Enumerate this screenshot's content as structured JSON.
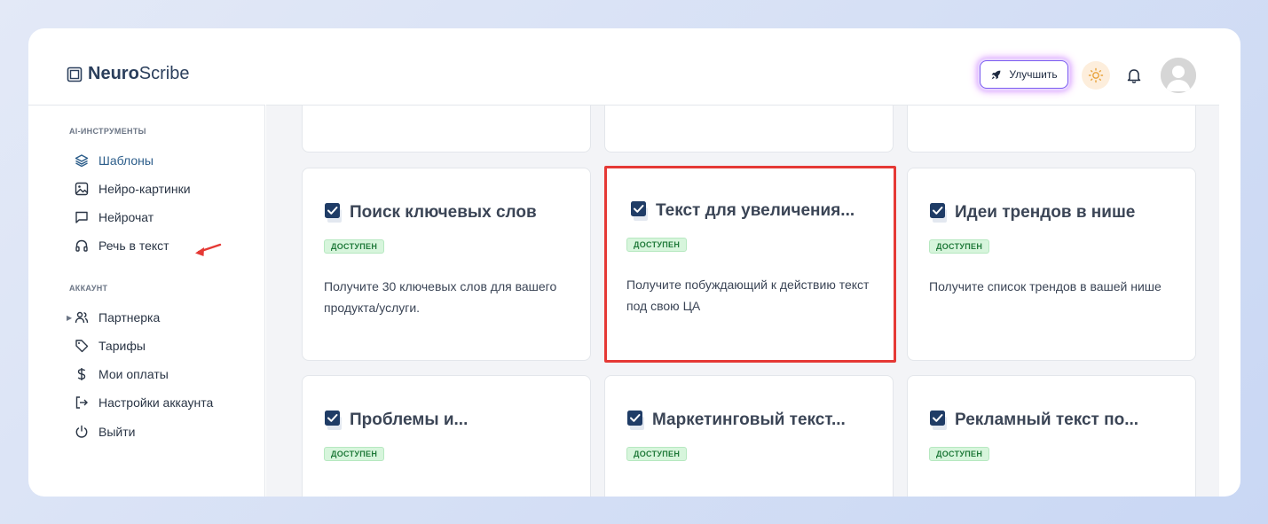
{
  "app": {
    "logo_bold": "Neuro",
    "logo_light": "Scribe"
  },
  "header": {
    "upgrade_label": "Улучшить"
  },
  "sidebar": {
    "section_tools": "AI-ИНСТРУМЕНТЫ",
    "tools": [
      {
        "label": "Шаблоны",
        "icon": "layers-icon",
        "active": true
      },
      {
        "label": "Нейро-картинки",
        "icon": "image-icon"
      },
      {
        "label": "Нейрочат",
        "icon": "chat-icon"
      },
      {
        "label": "Речь в текст",
        "icon": "headphones-icon"
      }
    ],
    "section_account": "АККАУНТ",
    "account": [
      {
        "label": "Партнерка",
        "icon": "users-icon"
      },
      {
        "label": "Тарифы",
        "icon": "tag-icon"
      },
      {
        "label": "Мои оплаты",
        "icon": "dollar-icon"
      },
      {
        "label": "Настройки аккаунта",
        "icon": "logout-arrow-icon"
      },
      {
        "label": "Выйти",
        "icon": "power-icon"
      }
    ]
  },
  "cards": [
    {
      "title": "Поиск ключевых слов",
      "badge": "ДОСТУПЕН",
      "desc": "Получите 30 ключевых слов для вашего продукта/услуги."
    },
    {
      "title": "Текст для увеличения...",
      "badge": "ДОСТУПЕН",
      "desc": "Получите побуждающий к действию текст под свою ЦА"
    },
    {
      "title": "Идеи трендов в нише",
      "badge": "ДОСТУПЕН",
      "desc": "Получите список трендов в вашей нише"
    },
    {
      "title": "Проблемы и...",
      "badge": "ДОСТУПЕН",
      "desc": ""
    },
    {
      "title": "Маркетинговый текст...",
      "badge": "ДОСТУПЕН",
      "desc": ""
    },
    {
      "title": "Рекламный текст по...",
      "badge": "ДОСТУПЕН",
      "desc": ""
    }
  ],
  "colors": {
    "accent": "#2c5d8a",
    "highlight": "#e53935",
    "badge_bg": "#d7f5dc",
    "badge_text": "#207a3a"
  }
}
